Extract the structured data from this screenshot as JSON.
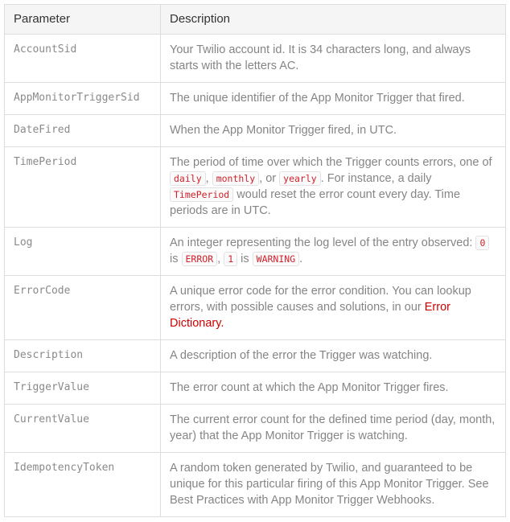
{
  "table": {
    "columns": [
      {
        "key": "parameter",
        "label": "Parameter"
      },
      {
        "key": "description",
        "label": "Description"
      }
    ],
    "rows": [
      {
        "parameter": "AccountSid",
        "description": "Your Twilio account id. It is 34 characters long, and always starts with the letters AC."
      },
      {
        "parameter": "AppMonitorTriggerSid",
        "description": "The unique identifier of the App Monitor Trigger that fired."
      },
      {
        "parameter": "DateFired",
        "description": "When the App Monitor Trigger fired, in UTC."
      },
      {
        "parameter": "TimePeriod",
        "description_parts": [
          {
            "type": "text",
            "value": "The period of time over which the Trigger counts errors, one of "
          },
          {
            "type": "code",
            "value": "daily"
          },
          {
            "type": "text",
            "value": ", "
          },
          {
            "type": "code",
            "value": "monthly"
          },
          {
            "type": "text",
            "value": ", or "
          },
          {
            "type": "code",
            "value": "yearly"
          },
          {
            "type": "text",
            "value": ". For instance, a daily "
          },
          {
            "type": "code",
            "value": "TimePeriod"
          },
          {
            "type": "text",
            "value": " would reset the error count every day. Time periods are in UTC."
          }
        ]
      },
      {
        "parameter": "Log",
        "description_parts": [
          {
            "type": "text",
            "value": "An integer representing the log level of the entry observed: "
          },
          {
            "type": "code",
            "value": "0"
          },
          {
            "type": "text",
            "value": " is "
          },
          {
            "type": "code",
            "value": "ERROR"
          },
          {
            "type": "text",
            "value": ", "
          },
          {
            "type": "code",
            "value": "1"
          },
          {
            "type": "text",
            "value": " is "
          },
          {
            "type": "code",
            "value": "WARNING"
          },
          {
            "type": "text",
            "value": "."
          }
        ]
      },
      {
        "parameter": "ErrorCode",
        "description_parts": [
          {
            "type": "text",
            "value": "A unique error code for the error condition. You can lookup errors, with possible causes and solutions, in our "
          },
          {
            "type": "link",
            "value": "Error Dictionary"
          },
          {
            "type": "link",
            "value": "."
          }
        ]
      },
      {
        "parameter": "Description",
        "description": "A description of the error the Trigger was watching."
      },
      {
        "parameter": "TriggerValue",
        "description": "The error count at which the App Monitor Trigger fires."
      },
      {
        "parameter": "CurrentValue",
        "description": "The current error count for the defined time period (day, month, year) that the App Monitor Trigger is watching."
      },
      {
        "parameter": "IdempotencyToken",
        "description": "A random token generated by Twilio, and guaranteed to be unique for this particular firing of this App Monitor Trigger. See Best Practices with App Monitor Trigger Webhooks."
      }
    ]
  },
  "colors": {
    "header_background": "#f5f5f5",
    "border": "#dddddd",
    "body_text": "#858585",
    "param_text": "#8a8a8a",
    "header_text": "#333333",
    "code_text": "#d4202a",
    "link_text": "#cc0000"
  }
}
